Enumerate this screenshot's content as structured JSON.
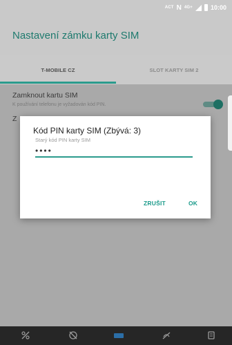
{
  "status_bar": {
    "network_label": "ACT",
    "nfc": "N",
    "data_type": "4G+",
    "time": "10:00"
  },
  "app_title": "Nastavení zámku karty SIM",
  "tabs": [
    {
      "label": "T-MOBILE CZ",
      "selected": true
    },
    {
      "label": "SLOT KARTY SIM 2",
      "selected": false
    }
  ],
  "settings": {
    "lock_sim_title": "Zamknout kartu SIM",
    "lock_sim_summary": "K používání telefonu je vyžadován kód PIN.",
    "lock_sim_enabled": true,
    "change_pin_title_partial": "Z"
  },
  "dialog": {
    "title": "Kód PIN karty SIM (Zbývá: 3)",
    "hint": "Starý kód PIN karty SIM",
    "pin_masked_value": "••••",
    "cancel_label": "ZRUŠIT",
    "ok_label": "OK"
  },
  "nav_icons": [
    "scissors-off-icon",
    "rotate-off-icon",
    "keyboard-icon",
    "dnd-off-icon",
    "clipboard-icon"
  ],
  "colors": {
    "accent": "#2b9b8d",
    "title_text": "#1e7a6e",
    "button_text": "#1a9a8a",
    "scrim_bar": "#c9c9c9",
    "nav_bar": "#262626"
  }
}
